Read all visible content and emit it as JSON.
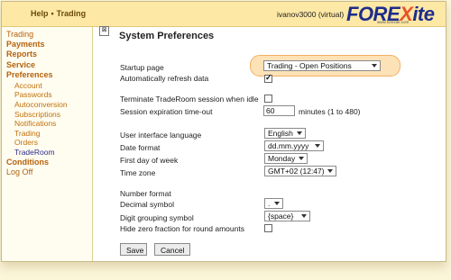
{
  "header": {
    "help": "Help",
    "trading": "Trading",
    "user": "ivanov3000 (virtual)",
    "logo_text": "FOREXite",
    "logo_url": "www.forexite.com"
  },
  "sidebar": {
    "items": [
      {
        "label": "Trading"
      },
      {
        "label": "Payments"
      },
      {
        "label": "Reports"
      },
      {
        "label": "Service"
      },
      {
        "label": "Preferences"
      },
      {
        "label": "Account"
      },
      {
        "label": "Passwords"
      },
      {
        "label": "Autoconversion"
      },
      {
        "label": "Subscriptions"
      },
      {
        "label": "Notifications"
      },
      {
        "label": "Trading"
      },
      {
        "label": "Orders"
      },
      {
        "label": "TradeRoom"
      },
      {
        "label": "Conditions"
      },
      {
        "label": "Log Off"
      }
    ]
  },
  "collapse_glyph": "⊠",
  "main": {
    "title": "System Preferences",
    "startup_label": "Startup page",
    "startup_value": "Trading - Open Positions",
    "auto_refresh_label": "Automatically refresh data",
    "auto_refresh_checked": true,
    "terminate_label": "Terminate TradeRoom session when idle",
    "terminate_checked": false,
    "expiration_label": "Session expiration time-out",
    "expiration_value": "60",
    "expiration_unit": "minutes (1 to 480)",
    "language_label": "User interface language",
    "language_value": "English",
    "date_format_label": "Date format",
    "date_format_value": "dd.mm.yyyy",
    "first_day_label": "First day of week",
    "first_day_value": "Monday",
    "timezone_label": "Time zone",
    "timezone_value": "GMT+02 (12:47)",
    "number_format_label": "Number format",
    "decimal_label": "Decimal symbol",
    "decimal_value": ".",
    "grouping_label": "Digit grouping symbol",
    "grouping_value": "{space}",
    "hide_zero_label": "Hide zero fraction for round amounts",
    "hide_zero_checked": false,
    "save_label": "Save",
    "cancel_label": "Cancel"
  },
  "colors": {
    "accent_orange": "#c0700e",
    "header_bg": "#fde8a5",
    "highlight_bg": "#fde2b7"
  }
}
